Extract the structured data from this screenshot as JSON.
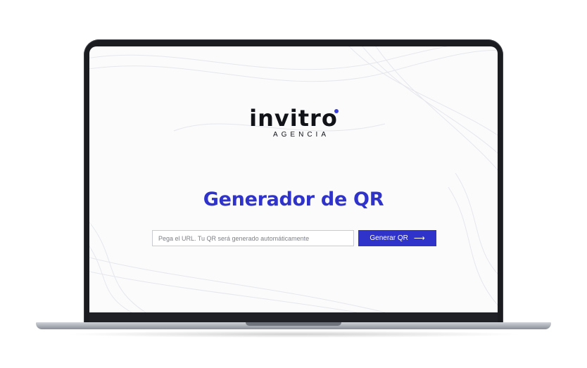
{
  "brand": {
    "logo_word": "invitro",
    "logo_sub": "AGENCIA",
    "accent": "#2f33c9",
    "dark": "#111318"
  },
  "main": {
    "title": "Generador de QR",
    "input_placeholder": "Pega el URL. Tu QR será generado automáticamente",
    "button_label": "Generar QR",
    "button_icon": "arrow-right-icon"
  }
}
